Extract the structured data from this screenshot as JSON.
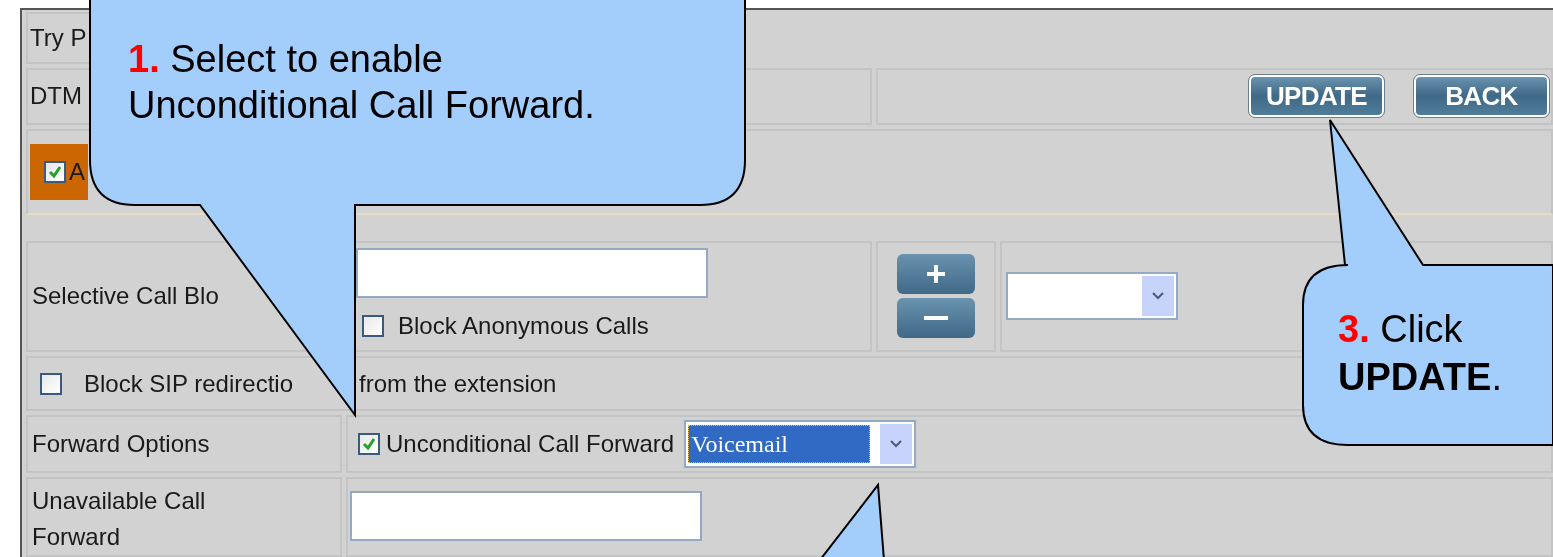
{
  "peer_rtp": {
    "label": "Try P"
  },
  "dtmf": {
    "label": "DTM"
  },
  "buttons": [
    "UPDATE",
    "BACK"
  ],
  "feature_toggle": {
    "label": "A",
    "checked": true
  },
  "selective_call_blocking": {
    "label": "Selective Call Blo",
    "block_anonymous": {
      "label": "Block Anonymous Calls",
      "checked": false
    }
  },
  "block_sip": {
    "label": "Block SIP redirectio",
    "label_after": "from the extension",
    "checked": false
  },
  "forward_options": {
    "label": "Forward Options",
    "unconditional": {
      "label": "Unconditional Call Forward",
      "checked": true
    },
    "destination": "Voicemail"
  },
  "unavailable": {
    "label": "Unavailable Call Forward"
  },
  "callouts": [
    {
      "number": "1.",
      "text": "Select to enable Unconditional Call Forward."
    },
    {
      "number": "3.",
      "text": "Click **UPDATE**."
    }
  ]
}
